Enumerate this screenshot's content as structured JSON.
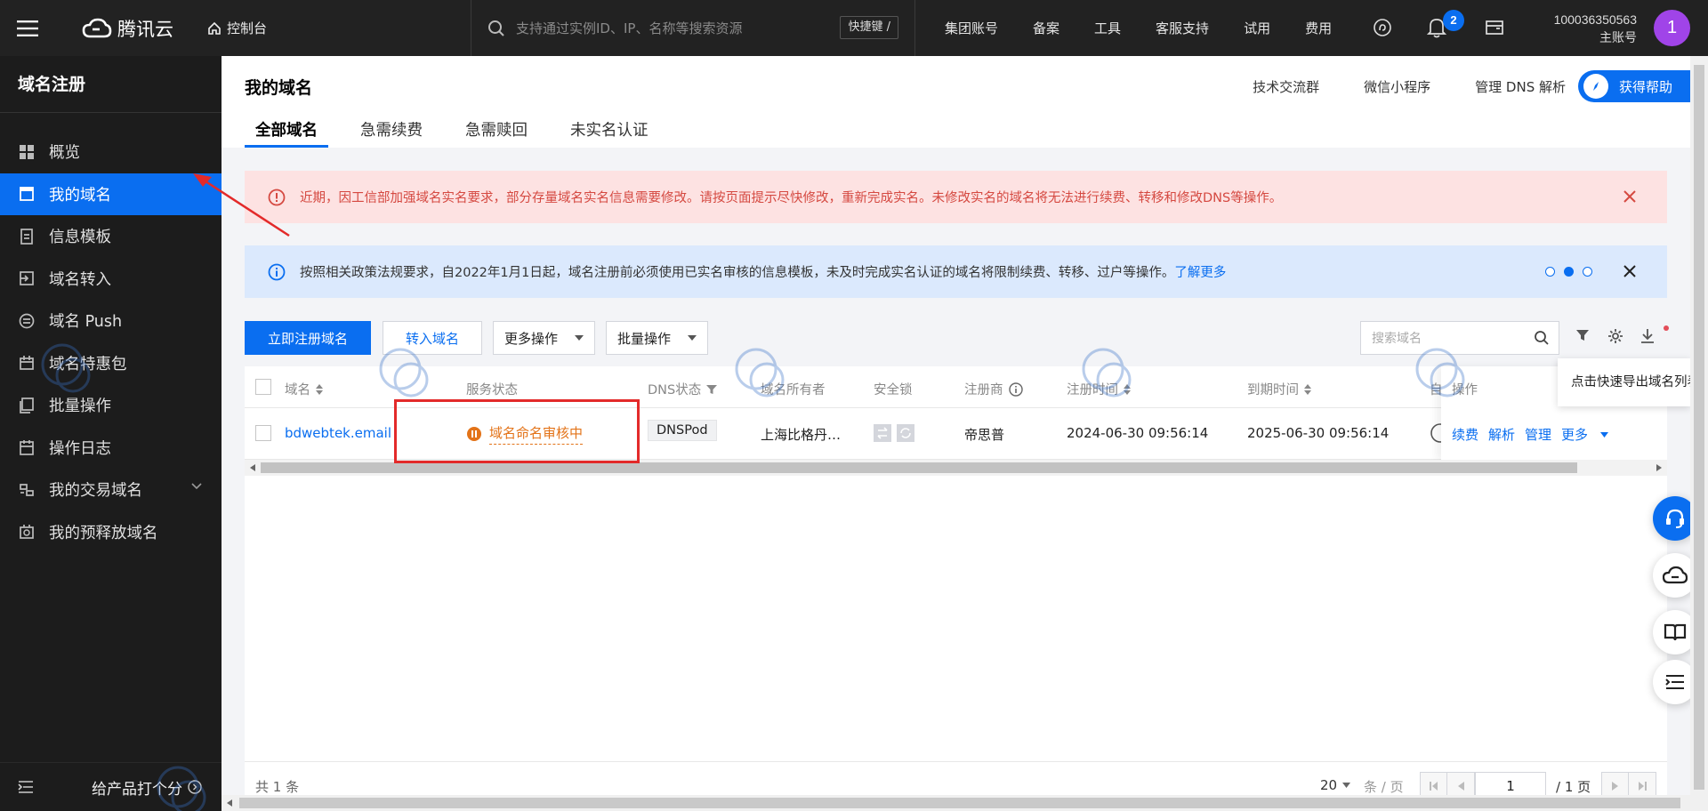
{
  "topbar": {
    "brand": "腾讯云",
    "console": "控制台",
    "search_placeholder": "支持通过实例ID、IP、名称等搜索资源",
    "shortcut": "快捷键 /",
    "nav": [
      "集团账号",
      "备案",
      "工具",
      "客服支持",
      "试用",
      "费用"
    ],
    "notification_count": "2",
    "account_id": "100036350563",
    "account_role": "主账号",
    "avatar_initial": "1"
  },
  "sidebar": {
    "title": "域名注册",
    "items": [
      {
        "label": "概览",
        "icon": "dashboard-icon"
      },
      {
        "label": "我的域名",
        "icon": "domain-icon",
        "active": true
      },
      {
        "label": "信息模板",
        "icon": "template-icon"
      },
      {
        "label": "域名转入",
        "icon": "transfer-in-icon"
      },
      {
        "label": "域名 Push",
        "icon": "push-icon"
      },
      {
        "label": "域名特惠包",
        "icon": "package-icon"
      },
      {
        "label": "批量操作",
        "icon": "batch-icon"
      },
      {
        "label": "操作日志",
        "icon": "log-icon"
      },
      {
        "label": "我的交易域名",
        "icon": "trade-icon"
      },
      {
        "label": "我的预释放域名",
        "icon": "prerelease-icon"
      }
    ],
    "footer_rate": "给产品打个分"
  },
  "header": {
    "title": "我的域名",
    "links": [
      "技术交流群",
      "微信小程序",
      "管理 DNS 解析"
    ],
    "help": "获得帮助",
    "tabs": [
      "全部域名",
      "急需续费",
      "急需赎回",
      "未实名认证"
    ]
  },
  "alerts": {
    "error": "近期，因工信部加强域名实名要求，部分存量域名实名信息需要修改。请按页面提示尽快修改，重新完成实名。未修改实名的域名将无法进行续费、转移和修改DNS等操作。",
    "info": "按照相关政策法规要求，自2022年1月1日起，域名注册前必须使用已实名审核的信息模板，未及时完成实名认证的域名将限制续费、转移、过户等操作。",
    "info_link": "了解更多"
  },
  "toolbar": {
    "register": "立即注册域名",
    "transfer": "转入域名",
    "more_ops": "更多操作",
    "batch_ops": "批量操作",
    "search_placeholder": "搜索域名",
    "export_tooltip": "点击快速导出域名列表"
  },
  "table": {
    "headers": [
      "域名",
      "服务状态",
      "DNS状态",
      "域名所有者",
      "安全锁",
      "注册商",
      "注册时间",
      "到期时间",
      "自",
      "操作"
    ],
    "rows": [
      {
        "domain": "bdwebtek.email",
        "status": "域名命名审核中",
        "dns": "DNSPod",
        "owner": "上海比格丹…",
        "registrar": "帝思普",
        "reg_time": "2024-06-30 09:56:14",
        "exp_time": "2025-06-30 09:56:14",
        "actions": [
          "续费",
          "解析",
          "管理",
          "更多"
        ]
      }
    ]
  },
  "pager": {
    "total": "共 1 条",
    "page_size": "20",
    "per_page_unit": "条 / 页",
    "current_page": "1",
    "total_pages": "/ 1 页"
  },
  "colors": {
    "accent": "#0a6ef0",
    "warning": "#e37318",
    "error_bg": "#fde2e2",
    "info_bg": "#dbe9fd"
  }
}
